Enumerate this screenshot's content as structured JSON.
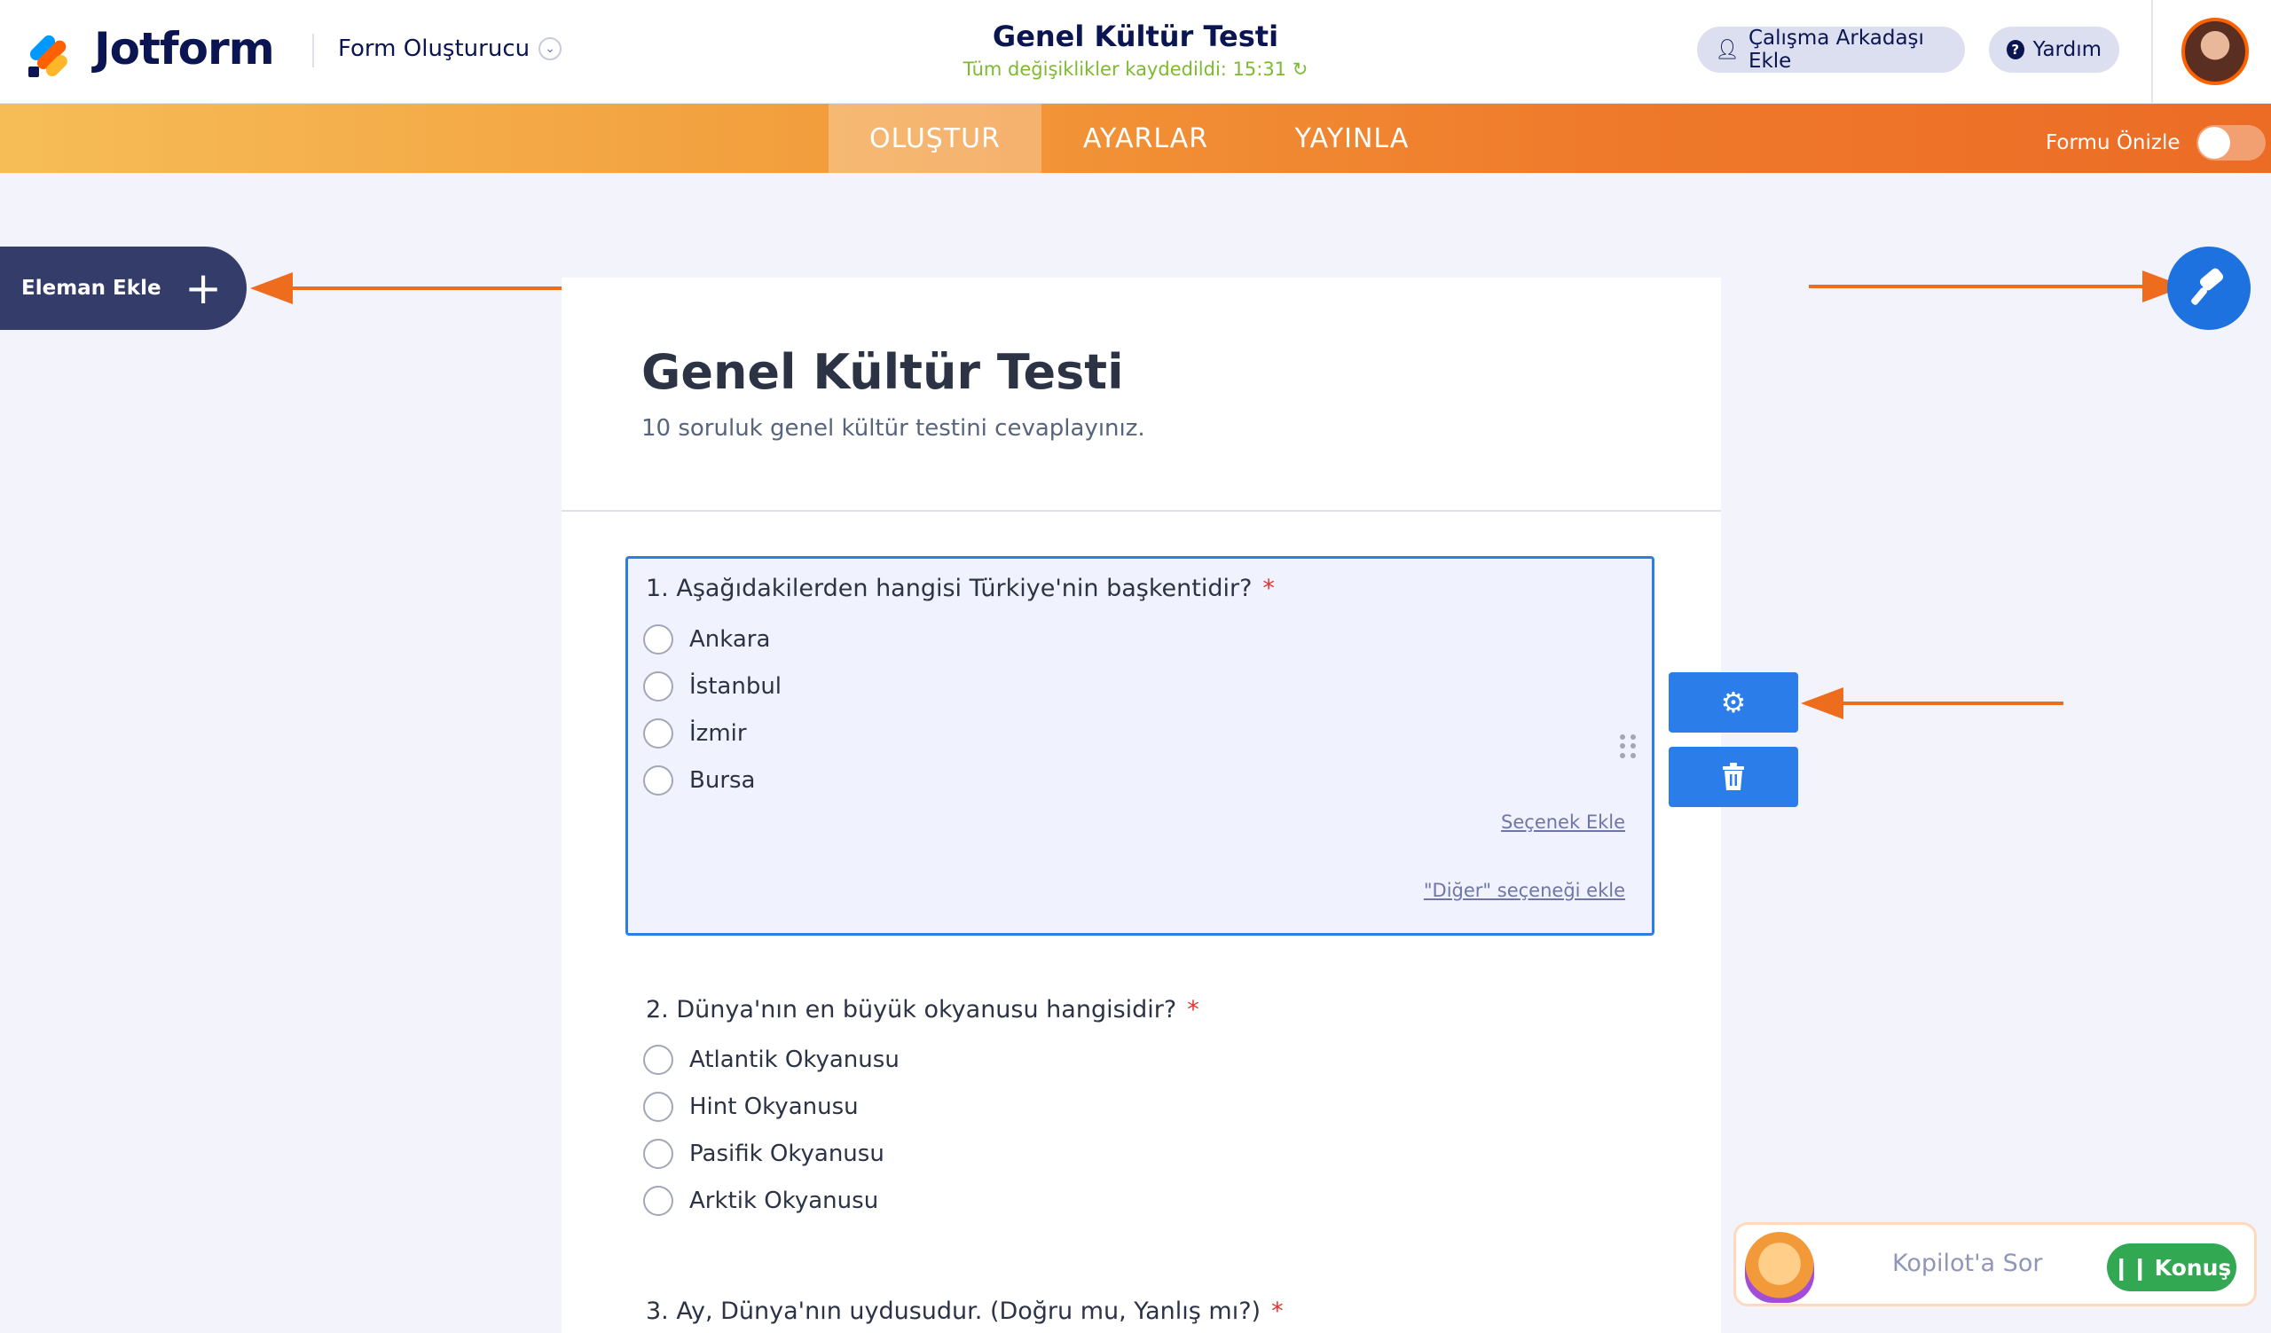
{
  "header": {
    "logo_text": "Jotform",
    "builder_label": "Form Oluşturucu",
    "form_title": "Genel Kültür Testi",
    "save_status": "Tüm değişiklikler kaydedildi: 15:31",
    "invite_label": "Çalışma Arkadaşı Ekle",
    "help_label": "Yardım"
  },
  "nav": {
    "tabs": [
      {
        "label": "OLUŞTUR",
        "active": true
      },
      {
        "label": "AYARLAR",
        "active": false
      },
      {
        "label": "YAYINLA",
        "active": false
      }
    ],
    "preview_label": "Formu Önizle",
    "preview_enabled": false
  },
  "sidebar": {
    "add_element_label": "Eleman Ekle"
  },
  "form": {
    "title": "Genel Kültür Testi",
    "subtitle": "10 soruluk genel kültür testini cevaplayınız.",
    "questions": [
      {
        "label": "1. Aşağıdakilerden hangisi Türkiye'nin başkentidir?",
        "required": "*",
        "options": [
          "Ankara",
          "İstanbul",
          "İzmir",
          "Bursa"
        ],
        "add_option_link": "Seçenek Ekle",
        "add_other_link": "\"Diğer\" seçeneği ekle"
      },
      {
        "label": "2. Dünya'nın en büyük okyanusu hangisidir?",
        "required": "*",
        "options": [
          "Atlantik Okyanusu",
          "Hint Okyanusu",
          "Pasifik Okyanusu",
          "Arktik Okyanusu"
        ]
      },
      {
        "label": "3. Ay, Dünya'nın uydusudur. (Doğru mu, Yanlış mı?)",
        "required": "*"
      }
    ]
  },
  "copilot": {
    "placeholder": "Kopilot'a Sor",
    "speak_label": "Konuş"
  },
  "colors": {
    "accent_blue": "#2b7de9",
    "brand_orange": "#ff6100",
    "navy": "#0a1551",
    "saved_green": "#7dba2f"
  }
}
